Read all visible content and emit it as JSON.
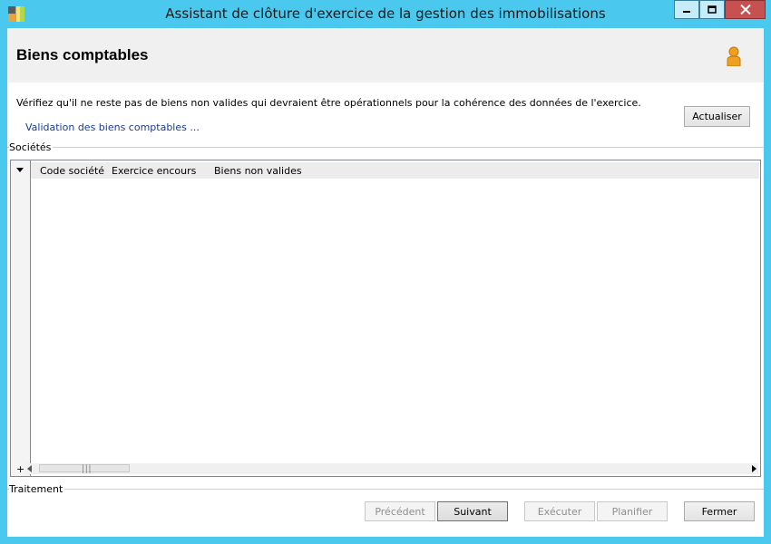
{
  "window": {
    "title": "Assistant de clôture d'exercice de la gestion des immobilisations",
    "app_icon": "app-icon",
    "controls": {
      "minimize": "minimize-icon",
      "maximize": "maximize-icon",
      "close": "close-icon"
    }
  },
  "header": {
    "title": "Biens comptables",
    "icon": "user-icon"
  },
  "content": {
    "description": "Vérifiez qu'il ne reste pas de biens non valides qui devraient être opérationnels pour la cohérence des données de l'exercice.",
    "validation_link": "Validation des biens comptables ...",
    "refresh_button": "Actualiser"
  },
  "societes": {
    "group_label": "Sociétés",
    "columns": [
      "Code société",
      "Exercice encours",
      "Biens non valides"
    ],
    "rows": [],
    "add_row_symbol": "+"
  },
  "traitement": {
    "group_label": "Traitement",
    "buttons": {
      "precedent": "Précédent",
      "suivant": "Suivant",
      "executer": "Exécuter",
      "planifier": "Planifier",
      "fermer": "Fermer"
    }
  },
  "colors": {
    "frame": "#4bc8ee",
    "close_button": "#c75050",
    "link": "#1a3c8f"
  }
}
